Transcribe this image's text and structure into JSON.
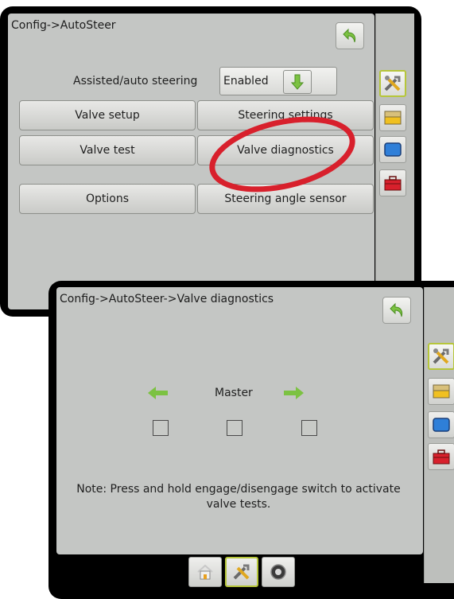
{
  "screen1": {
    "breadcrumb": "Config->AutoSteer",
    "assisted_label": "Assisted/auto steering",
    "assisted_value": "Enabled",
    "buttons": [
      {
        "label": "Valve setup"
      },
      {
        "label": "Steering settings"
      },
      {
        "label": "Valve test"
      },
      {
        "label": "Valve diagnostics"
      },
      {
        "label": "Options"
      },
      {
        "label": "Steering angle sensor"
      }
    ],
    "highlight_color": "#d8202c"
  },
  "screen2": {
    "breadcrumb": "Config->AutoSteer->Valve diagnostics",
    "master_label": "Master",
    "note": "Note: Press and hold engage/disengage switch to activate valve tests."
  },
  "colors": {
    "panel": "#c4c6c4",
    "green_arrow": "#7cc242",
    "active_tab_border": "#b6c63a"
  },
  "sidebar_icons": [
    "tools-icon",
    "console-icon",
    "display-icon",
    "toolbox-icon"
  ],
  "bottom_tabs": [
    "home-icon",
    "tools-icon",
    "gauge-icon"
  ]
}
